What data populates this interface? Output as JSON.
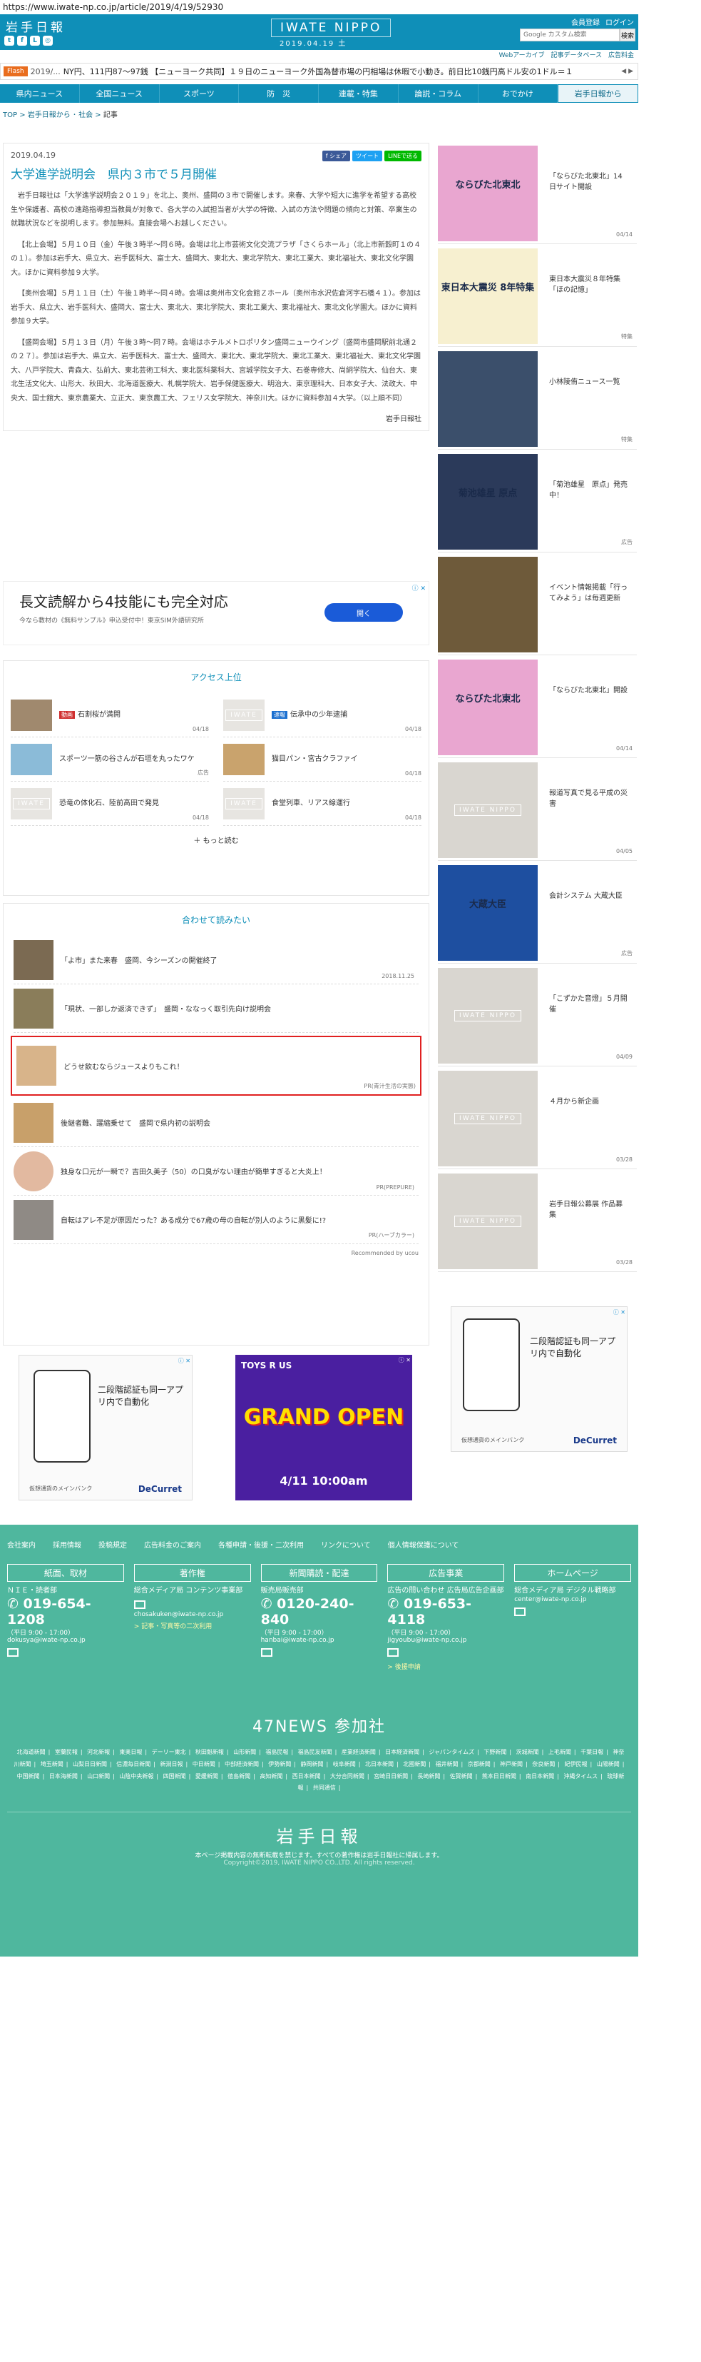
{
  "url": "https://www.iwate-np.co.jp/article/2019/4/19/52930",
  "header": {
    "logo_jp": "岩手日報",
    "logo_en": "IWATE NIPPO",
    "date": "2019.04.19 土",
    "top_links": [
      "会員登録",
      "ログイン"
    ],
    "search_placeholder": "Google カスタム検索",
    "search_button": "検索",
    "sub_links": [
      "Webアーカイブ",
      "記事データベース",
      "広告料金"
    ]
  },
  "flash": {
    "label": "Flash",
    "time": "2019/...",
    "text": "NY円、111円87〜97銭 【ニューヨーク共同】１９日のニューヨーク外国為替市場の円相場は休暇で小動き。前日比10銭円高ドル安の1ドル＝１"
  },
  "nav": [
    "県内ニュース",
    "全国ニュース",
    "スポーツ",
    "防　災",
    "連載・特集",
    "論説・コラム",
    "おでかけ",
    "岩手日報から"
  ],
  "breadcrumb": [
    "TOP",
    "岩手日報から",
    "社会",
    "記事"
  ],
  "article": {
    "date": "2019.04.19",
    "share": [
      "f シェア",
      "ツイート",
      "LINEで送る"
    ],
    "title": "大学進学説明会　県内３市で５月開催",
    "paragraphs": [
      "岩手日報社は「大学進学説明会２０１９」を北上、奥州、盛岡の３市で開催します。来春、大学や短大に進学を希望する高校生や保護者、高校の進路指導担当教員が対象で、各大学の入試担当者が大学の特徴、入試の方法や問題の傾向と対策、卒業生の就職状況などを説明します。参加無料。直接会場へお越しください。",
      "【北上会場】５月１０日（金）午後３時半〜同６時。会場は北上市芸術文化交流プラザ「さくらホール」（北上市新穀町１の４の１）。参加は岩手大、県立大、岩手医科大、富士大、盛岡大、東北大、東北学院大、東北工業大、東北福祉大、東北文化学園大。ほかに資料参加９大学。",
      "【奥州会場】５月１１日（土）午後１時半〜同４時。会場は奥州市文化会館Ｚホール（奥州市水沢佐倉河字石橋４１）。参加は岩手大、県立大、岩手医科大、盛岡大、富士大、東北大、東北学院大、東北工業大、東北福祉大、東北文化学園大。ほかに資料参加９大学。",
      "【盛岡会場】５月１３日（月）午後３時〜同７時。会場はホテルメトロポリタン盛岡ニューウイング（盛岡市盛岡駅前北通２の２７）。参加は岩手大、県立大、岩手医科大、富士大、盛岡大、東北大、東北学院大、東北工業大、東北福祉大、東北文化学園大、八戸学院大、青森大、弘前大、東北芸術工科大、東北医科薬科大、宮城学院女子大、石巻専修大、尚絅学院大、仙台大、東北生活文化大、山形大、秋田大、北海道医療大、札幌学院大、岩手保健医療大、明治大、東京理科大、日本女子大、法政大、中央大、国士舘大、東京農業大、立正大、東京農工大、フェリス女学院大、神奈川大。ほかに資料参加４大学。（以上順不同）"
    ],
    "source": "岩手日報社"
  },
  "ad1": {
    "title": "長文読解から4技能にも完全対応",
    "sub": "今なら教材の《無料サンプル》申込受付中！東京SIM外語研究所",
    "button": "開く"
  },
  "ranking": {
    "title": "アクセス上位",
    "items": [
      {
        "tag": "動画",
        "title": "石割桜が満開",
        "date": "04/18"
      },
      {
        "tag": "速報",
        "title": "伝承中の少年逮捕",
        "date": "04/18"
      },
      {
        "tag": "",
        "title": "スポーツ一筋の谷さんが石垣を丸ったワケ",
        "date": "広告"
      },
      {
        "tag": "",
        "title": "猫目パン・宮古クラファイ",
        "date": "04/18"
      },
      {
        "tag": "",
        "title": "恐竜の体化石、陸前高田で発見",
        "date": "04/18"
      },
      {
        "tag": "",
        "title": "食堂列車、リアス線運行",
        "date": "04/18"
      }
    ],
    "more": "もっと読む"
  },
  "recommend": {
    "title": "合わせて読みたい",
    "items": [
      {
        "title": "「よ市」また来春　盛岡、今シーズンの開催終了",
        "meta": "2018.11.25"
      },
      {
        "title": "「現状、一部しか返済できず」　盛岡・ななっく取引先向け説明会",
        "meta": ""
      },
      {
        "title": "どうせ飲むならジュースよりもこれ！",
        "meta": "PR(青汁生活の実態)"
      },
      {
        "title": "後継者難、躍縮乗せて　盛岡で県内初の説明会",
        "meta": ""
      },
      {
        "title": "独身な口元が一瞬で？吉田久美子（50）の口臭がない理由が簡単すぎると大炎上！",
        "meta": "PR(PREPURE)"
      },
      {
        "title": "自転はアレ不足が原因だった？ある成分で67歳の母の自転が別人のように黒髪に!?",
        "meta": "PR(ハーブカラー)"
      }
    ],
    "powered": "Recommended by ucou"
  },
  "bottom_ads": [
    {
      "title": "二段階認証も同一アプリ内で自動化",
      "brand": "DeCurret",
      "sub": "仮想通貨のメインバンク"
    },
    {
      "title": "GRAND OPEN",
      "sub": "4/11 10:00am",
      "brand": "TOYS R US"
    }
  ],
  "sidebar": [
    {
      "title": "「ならびた北東北」14日サイト開設",
      "date": "04/14",
      "bg": "#e9a6d0",
      "label": "ならびた北東北"
    },
    {
      "title": "東日本大震災８年特集「ほの記憶」",
      "date": "特集",
      "bg": "#f7f0d0",
      "label": "東日本大震災 8年特集"
    },
    {
      "title": "小林陵侑ニュース一覧",
      "date": "特集",
      "bg": "#3b4f6b",
      "label": ""
    },
    {
      "title": "「菊池雄星　原点」発売中！",
      "date": "広告",
      "bg": "#2b3a5a",
      "label": "菊池雄星 原点"
    },
    {
      "title": "イベント情報掲載「行ってみよう」は毎週更新",
      "date": "",
      "bg": "#6e5a3a",
      "label": ""
    },
    {
      "title": "「ならびた北東北」開設",
      "date": "04/14",
      "bg": "#e9a6d0",
      "label": "ならびた北東北"
    },
    {
      "title": "報道写真で見る平成の災害",
      "date": "04/05",
      "bg": "#d9d6d0",
      "label": "IWATE NIPPO"
    },
    {
      "title": "会計システム 大蔵大臣",
      "date": "広告",
      "bg": "#1e4fa0",
      "label": "大蔵大臣"
    },
    {
      "title": "「こずかた音燈」５月開催",
      "date": "04/09",
      "bg": "#d9d6d0",
      "label": "IWATE NIPPO"
    },
    {
      "title": "４月から新企画",
      "date": "03/28",
      "bg": "#d9d6d0",
      "label": "IWATE NIPPO"
    },
    {
      "title": "岩手日報公募展 作品募集",
      "date": "03/28",
      "bg": "#d9d6d0",
      "label": "IWATE NIPPO"
    }
  ],
  "footer": {
    "links": [
      "会社案内",
      "採用情報",
      "投稿規定",
      "広告料金のご案内",
      "各種申請・後援・二次利用",
      "リンクについて",
      "個人情報保護について"
    ],
    "cols": [
      {
        "head": "紙面、取材",
        "dept": "ＮＩＥ・読者部",
        "tel": "019-654-1208",
        "hours": "（平日 9:00 - 17:00）",
        "email": "dokusya@iwate-np.co.jp",
        "link": ""
      },
      {
        "head": "著作権",
        "dept": "総合メディア局 コンテンツ事業部",
        "tel": "",
        "hours": "",
        "email": "chosakuken@iwate-np.co.jp",
        "link": "> 記事・写真等の二次利用"
      },
      {
        "head": "新聞購読・配達",
        "dept": "販売局販売部",
        "tel": "0120-240-840",
        "hours": "（平日 9:00 - 17:00）",
        "email": "hanbai@iwate-np.co.jp",
        "link": ""
      },
      {
        "head": "広告事業",
        "dept": "広告の問い合わせ 広告局広告企画部",
        "tel": "019-653-4118",
        "hours": "（平日 9:00 - 17:00）",
        "email": "jigyoubu@iwate-np.co.jp",
        "link": "> 後援申請"
      },
      {
        "head": "ホームページ",
        "dept": "総合メディア局 デジタル戦略部",
        "tel": "",
        "hours": "",
        "email": "center@iwate-np.co.jp",
        "link": ""
      }
    ],
    "news47_title": "47NEWS 参加社",
    "news47": [
      "北海道新聞",
      "室蘭民報",
      "河北新報",
      "東奥日報",
      "デーリー東北",
      "秋田魁新報",
      "山形新聞",
      "福島民報",
      "福島民友新聞",
      "産業経済新聞",
      "日本経済新聞",
      "ジャパンタイムズ",
      "下野新聞",
      "茨城新聞",
      "上毛新聞",
      "千葉日報",
      "神奈川新聞",
      "埼玉新聞",
      "山梨日日新聞",
      "信濃毎日新聞",
      "新潟日報",
      "中日新聞",
      "中部経済新聞",
      "伊勢新聞",
      "静岡新聞",
      "岐阜新聞",
      "北日本新聞",
      "北國新聞",
      "福井新聞",
      "京都新聞",
      "神戸新聞",
      "奈良新聞",
      "紀伊民報",
      "山陽新聞",
      "中国新聞",
      "日本海新聞",
      "山口新聞",
      "山陰中央新報",
      "四国新聞",
      "愛媛新聞",
      "徳島新聞",
      "高知新聞",
      "西日本新聞",
      "大分合同新聞",
      "宮崎日日新聞",
      "長崎新聞",
      "佐賀新聞",
      "熊本日日新聞",
      "南日本新聞",
      "沖縄タイムス",
      "琉球新報",
      "共同通信"
    ],
    "logo": "岩手日報",
    "notice": "本ページ掲載内容の無断転載を禁じます。すべての著作権は岩手日報社に帰属します。",
    "copyright": "Copyright©2019, IWATE NIPPO CO.,LTD. All rights reserved."
  }
}
